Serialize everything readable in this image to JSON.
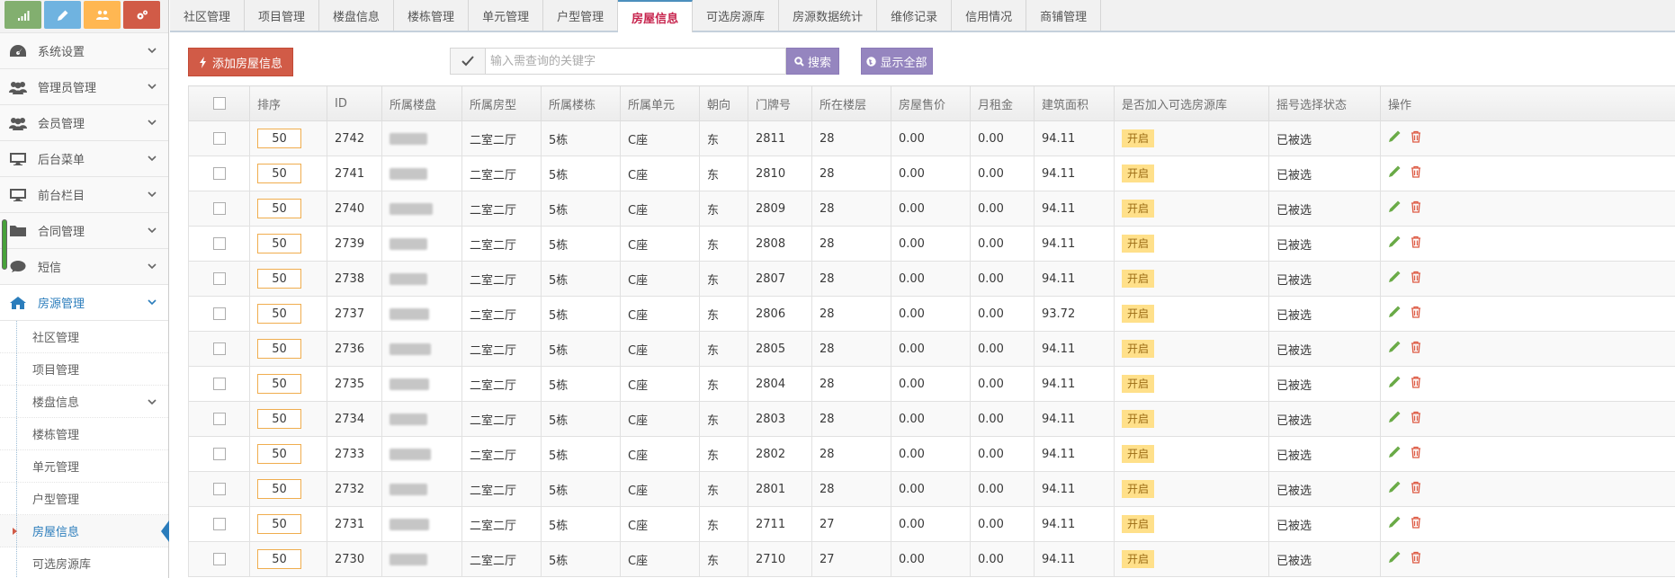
{
  "sidebar": {
    "menu": [
      {
        "label": "系统设置",
        "icon": "dashboard-icon"
      },
      {
        "label": "管理员管理",
        "icon": "users-icon"
      },
      {
        "label": "会员管理",
        "icon": "users-icon"
      },
      {
        "label": "后台菜单",
        "icon": "desktop-icon"
      },
      {
        "label": "前台栏目",
        "icon": "desktop-icon"
      },
      {
        "label": "合同管理",
        "icon": "folder-icon"
      },
      {
        "label": "短信",
        "icon": "comment-icon"
      },
      {
        "label": "房源管理",
        "icon": "home-icon"
      }
    ],
    "submenu": [
      {
        "label": "社区管理"
      },
      {
        "label": "项目管理"
      },
      {
        "label": "楼盘信息"
      },
      {
        "label": "楼栋管理"
      },
      {
        "label": "单元管理"
      },
      {
        "label": "户型管理"
      },
      {
        "label": "房屋信息"
      },
      {
        "label": "可选房源库"
      }
    ]
  },
  "tabs": [
    "社区管理",
    "项目管理",
    "楼盘信息",
    "楼栋管理",
    "单元管理",
    "户型管理",
    "房屋信息",
    "可选房源库",
    "房源数据统计",
    "维修记录",
    "信用情况",
    "商铺管理"
  ],
  "toolbar": {
    "add_label": "添加房屋信息",
    "search_placeholder": "输入需查询的关键字",
    "search_label": "搜索",
    "show_all_label": "显示全部"
  },
  "table": {
    "headers": [
      "排序",
      "ID",
      "所属楼盘",
      "所属房型",
      "所属楼栋",
      "所属单元",
      "朝向",
      "门牌号",
      "所在楼层",
      "房屋售价",
      "月租金",
      "建筑面积",
      "是否加入可选房源库",
      "摇号选择状态",
      "操作"
    ],
    "rows": [
      {
        "sort": "50",
        "id": "2742",
        "type": "二室二厅",
        "building": "5栋",
        "unit": "C座",
        "dir": "东",
        "door": "2811",
        "floor": "28",
        "price": "0.00",
        "rent": "0.00",
        "area": "94.11",
        "pool": "开启",
        "status": "已被选"
      },
      {
        "sort": "50",
        "id": "2741",
        "type": "二室二厅",
        "building": "5栋",
        "unit": "C座",
        "dir": "东",
        "door": "2810",
        "floor": "28",
        "price": "0.00",
        "rent": "0.00",
        "area": "94.11",
        "pool": "开启",
        "status": "已被选"
      },
      {
        "sort": "50",
        "id": "2740",
        "type": "二室二厅",
        "building": "5栋",
        "unit": "C座",
        "dir": "东",
        "door": "2809",
        "floor": "28",
        "price": "0.00",
        "rent": "0.00",
        "area": "94.11",
        "pool": "开启",
        "status": "已被选"
      },
      {
        "sort": "50",
        "id": "2739",
        "type": "二室二厅",
        "building": "5栋",
        "unit": "C座",
        "dir": "东",
        "door": "2808",
        "floor": "28",
        "price": "0.00",
        "rent": "0.00",
        "area": "94.11",
        "pool": "开启",
        "status": "已被选"
      },
      {
        "sort": "50",
        "id": "2738",
        "type": "二室二厅",
        "building": "5栋",
        "unit": "C座",
        "dir": "东",
        "door": "2807",
        "floor": "28",
        "price": "0.00",
        "rent": "0.00",
        "area": "94.11",
        "pool": "开启",
        "status": "已被选"
      },
      {
        "sort": "50",
        "id": "2737",
        "type": "二室二厅",
        "building": "5栋",
        "unit": "C座",
        "dir": "东",
        "door": "2806",
        "floor": "28",
        "price": "0.00",
        "rent": "0.00",
        "area": "93.72",
        "pool": "开启",
        "status": "已被选"
      },
      {
        "sort": "50",
        "id": "2736",
        "type": "二室二厅",
        "building": "5栋",
        "unit": "C座",
        "dir": "东",
        "door": "2805",
        "floor": "28",
        "price": "0.00",
        "rent": "0.00",
        "area": "94.11",
        "pool": "开启",
        "status": "已被选"
      },
      {
        "sort": "50",
        "id": "2735",
        "type": "二室二厅",
        "building": "5栋",
        "unit": "C座",
        "dir": "东",
        "door": "2804",
        "floor": "28",
        "price": "0.00",
        "rent": "0.00",
        "area": "94.11",
        "pool": "开启",
        "status": "已被选"
      },
      {
        "sort": "50",
        "id": "2734",
        "type": "二室二厅",
        "building": "5栋",
        "unit": "C座",
        "dir": "东",
        "door": "2803",
        "floor": "28",
        "price": "0.00",
        "rent": "0.00",
        "area": "94.11",
        "pool": "开启",
        "status": "已被选"
      },
      {
        "sort": "50",
        "id": "2733",
        "type": "二室二厅",
        "building": "5栋",
        "unit": "C座",
        "dir": "东",
        "door": "2802",
        "floor": "28",
        "price": "0.00",
        "rent": "0.00",
        "area": "94.11",
        "pool": "开启",
        "status": "已被选"
      },
      {
        "sort": "50",
        "id": "2732",
        "type": "二室二厅",
        "building": "5栋",
        "unit": "C座",
        "dir": "东",
        "door": "2801",
        "floor": "28",
        "price": "0.00",
        "rent": "0.00",
        "area": "94.11",
        "pool": "开启",
        "status": "已被选"
      },
      {
        "sort": "50",
        "id": "2731",
        "type": "二室二厅",
        "building": "5栋",
        "unit": "C座",
        "dir": "东",
        "door": "2711",
        "floor": "27",
        "price": "0.00",
        "rent": "0.00",
        "area": "94.11",
        "pool": "开启",
        "status": "已被选"
      },
      {
        "sort": "50",
        "id": "2730",
        "type": "二室二厅",
        "building": "5栋",
        "unit": "C座",
        "dir": "东",
        "door": "2710",
        "floor": "27",
        "price": "0.00",
        "rent": "0.00",
        "area": "94.11",
        "pool": "开启",
        "status": "已被选"
      }
    ]
  },
  "colors": {
    "accent_blue": "#2b7dbc",
    "danger_red": "#d15b47",
    "purple_btn": "#9585bf",
    "badge_yellow": "#ffe08a",
    "edit_green": "#69aa46",
    "delete_red": "#dd5a43"
  }
}
